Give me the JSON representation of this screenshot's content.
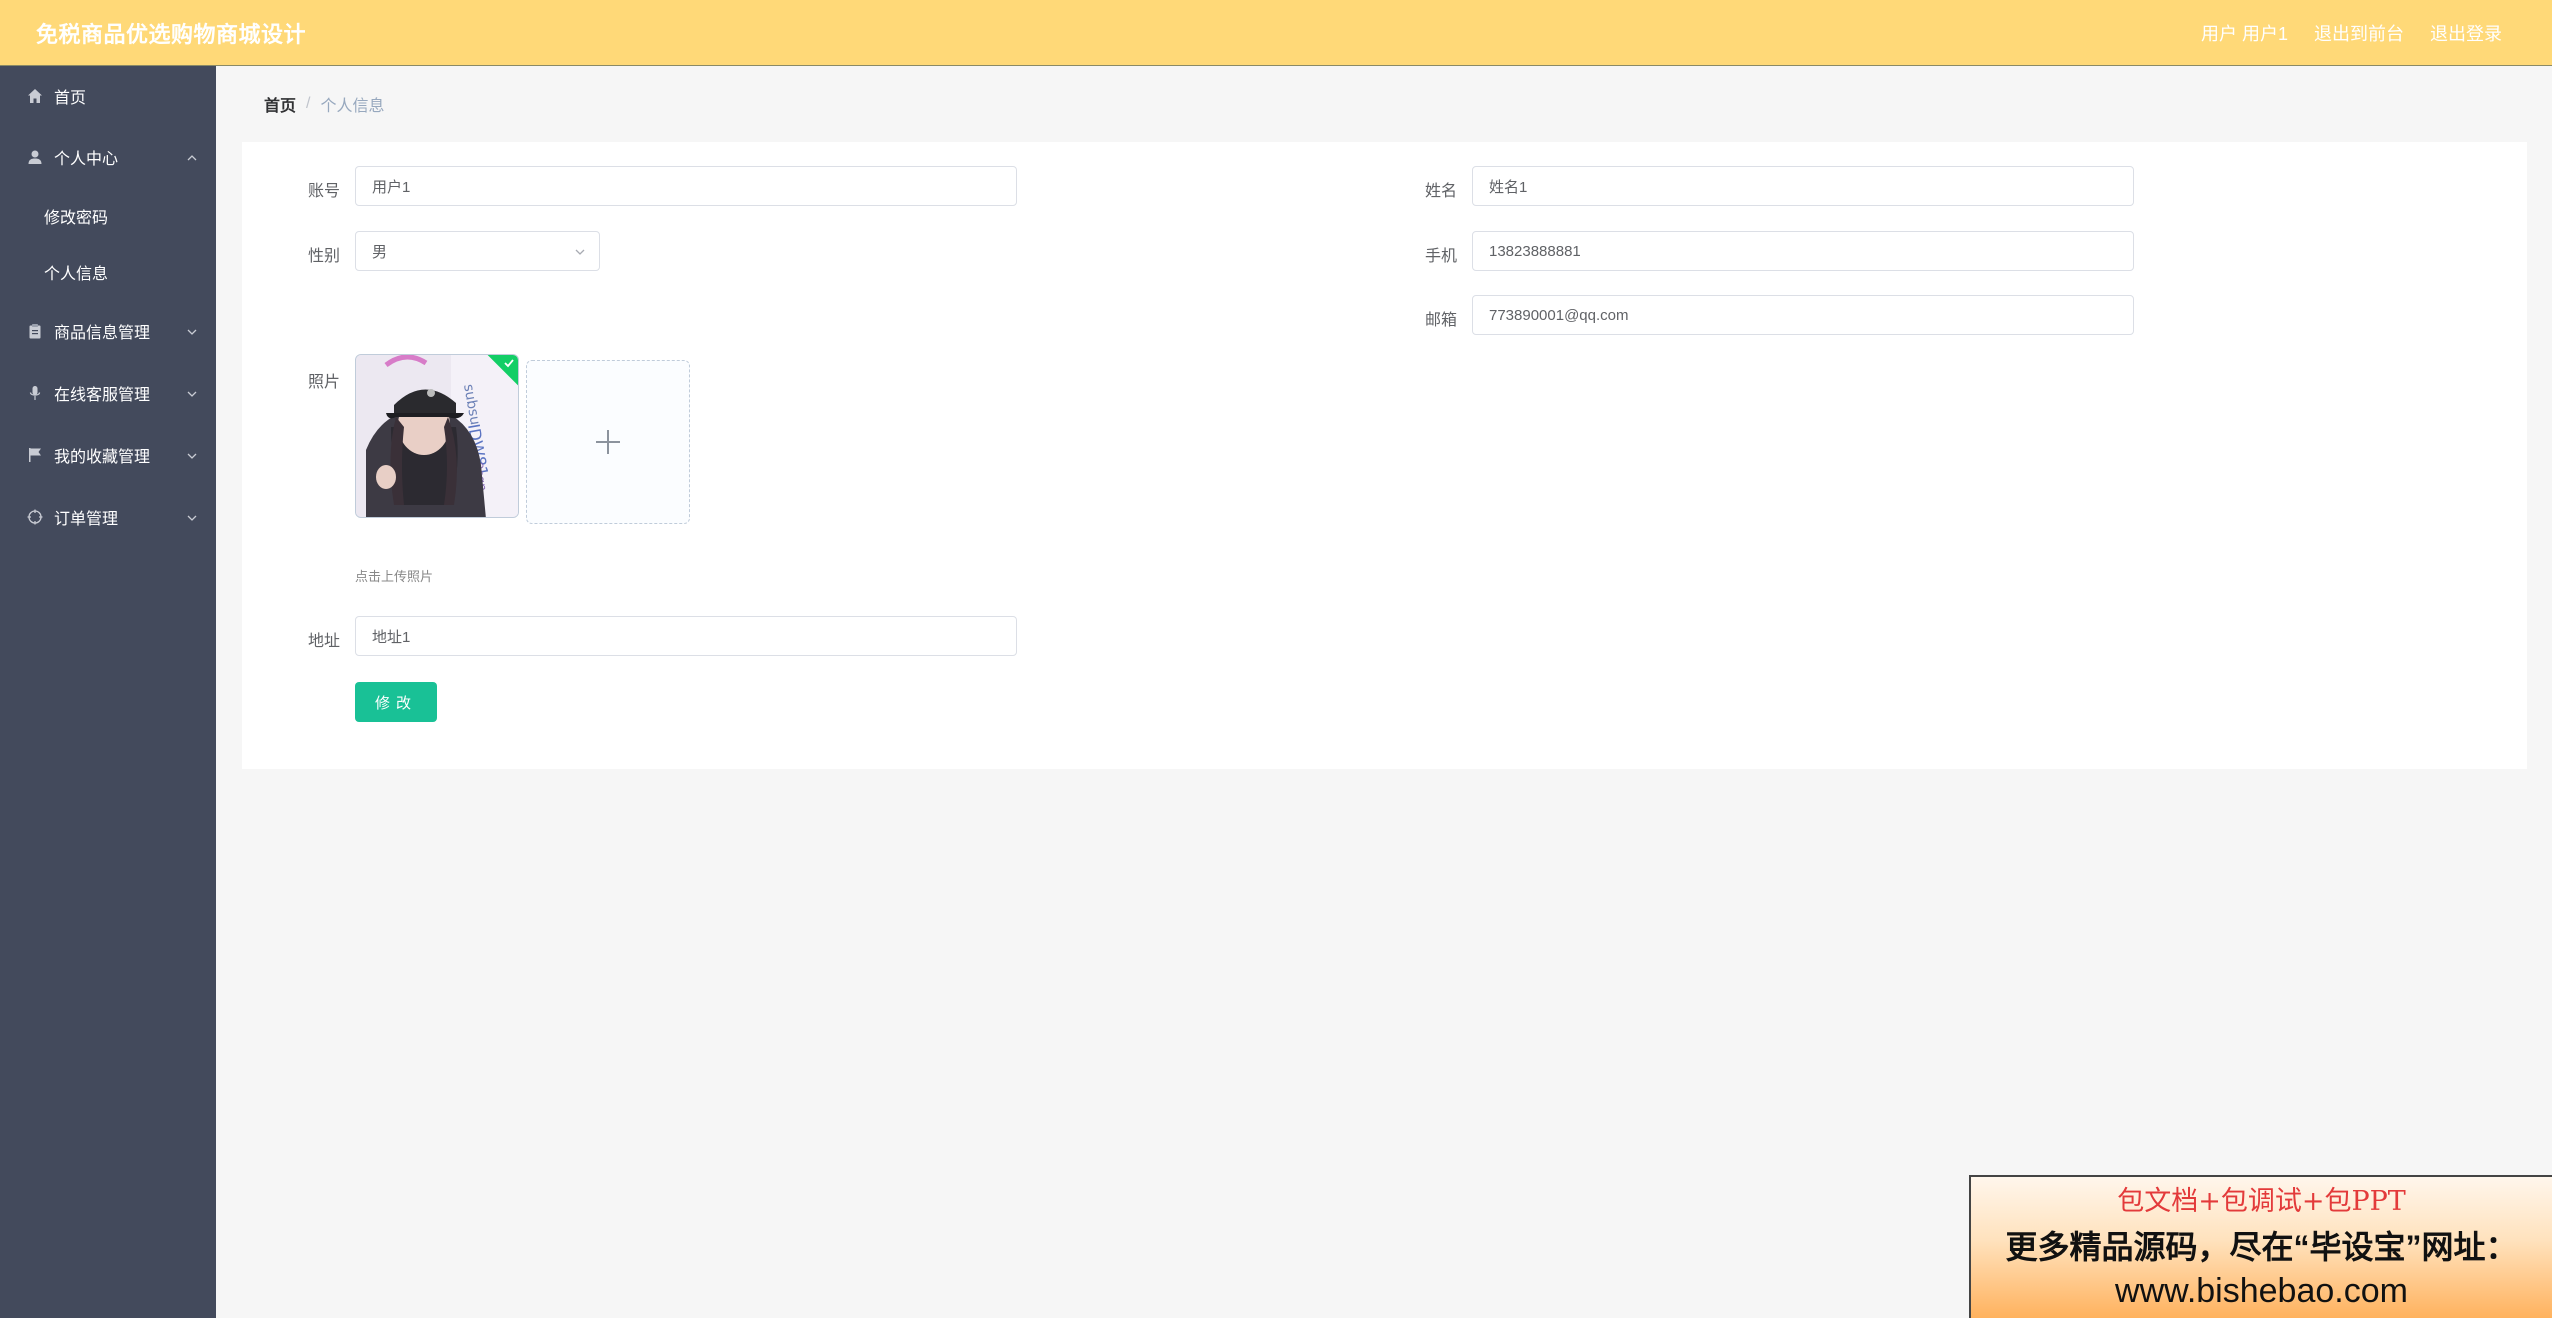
{
  "header": {
    "title": "免税商品优选购物商城设计",
    "user_label": "用户 用户1",
    "backend_link": "退出到前台",
    "logout_link": "退出登录"
  },
  "sidebar": {
    "items": [
      {
        "label": "首页",
        "icon": "home-icon"
      },
      {
        "label": "个人中心",
        "icon": "user-icon",
        "expanded": true,
        "children": [
          {
            "label": "修改密码"
          },
          {
            "label": "个人信息"
          }
        ]
      },
      {
        "label": "商品信息管理",
        "icon": "clipboard-icon"
      },
      {
        "label": "在线客服管理",
        "icon": "microphone-icon"
      },
      {
        "label": "我的收藏管理",
        "icon": "flag-icon"
      },
      {
        "label": "订单管理",
        "icon": "target-icon"
      }
    ]
  },
  "breadcrumb": {
    "home": "首页",
    "separator": "/",
    "current": "个人信息"
  },
  "form": {
    "account": {
      "label": "账号",
      "value": "用户1"
    },
    "name": {
      "label": "姓名",
      "value": "姓名1"
    },
    "gender": {
      "label": "性别",
      "value": "男"
    },
    "phone": {
      "label": "手机",
      "value": "13823888881"
    },
    "email": {
      "label": "邮箱",
      "value": "773890001@qq.com"
    },
    "photo": {
      "label": "照片",
      "hint": "点击上传照片"
    },
    "address": {
      "label": "地址",
      "value": "地址1"
    },
    "submit_label": "修改"
  },
  "promo": {
    "line1": "包文档+包调试+包PPT",
    "line2": "更多精品源码，尽在“毕设宝”网址：",
    "line3": "www.bishebao.com"
  },
  "colors": {
    "header_bg": "#ffd978",
    "sidebar_bg": "#434a5c",
    "primary_button": "#19c196",
    "success_badge": "#13ce66"
  }
}
